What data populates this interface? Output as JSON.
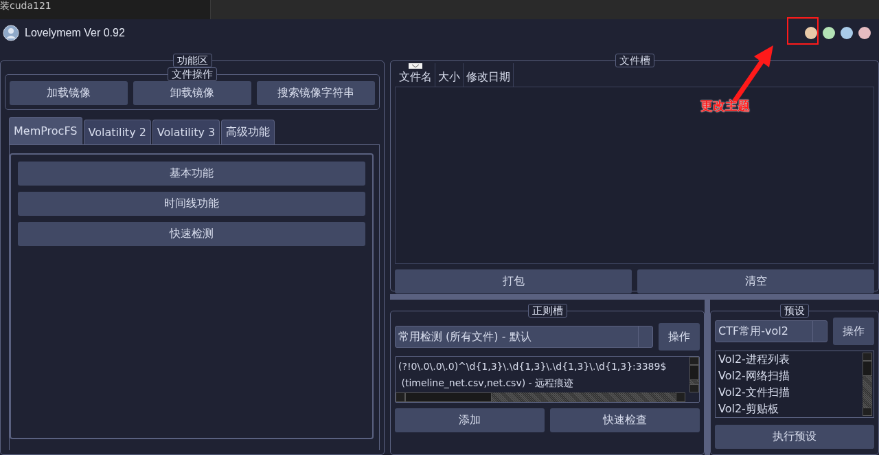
{
  "background_window": {
    "text": "装cuda121"
  },
  "window": {
    "title": "Lovelymem Ver 0.92",
    "theme_buttons": [
      {
        "color": "#e8c9a8"
      },
      {
        "color": "#b4e3b6"
      },
      {
        "color": "#a9cbe9"
      },
      {
        "color": "#e6bcc1"
      }
    ]
  },
  "function_area": {
    "title": "功能区",
    "file_ops": {
      "title": "文件操作",
      "buttons": [
        "加载镜像",
        "卸载镜像",
        "搜索镜像字符串"
      ]
    },
    "tabs": [
      {
        "label": "MemProcFS",
        "selected": true
      },
      {
        "label": "Volatility 2",
        "selected": false
      },
      {
        "label": "Volatility 3",
        "selected": false
      },
      {
        "label": "高级功能",
        "selected": false
      }
    ],
    "tab_buttons": [
      "基本功能",
      "时间线功能",
      "快速检测"
    ]
  },
  "file_slot": {
    "title": "文件槽",
    "columns": [
      {
        "label": "文件名",
        "sorted": true
      },
      {
        "label": "大小",
        "sorted": false
      },
      {
        "label": "修改日期",
        "sorted": false
      }
    ],
    "buttons": [
      "打包",
      "清空"
    ]
  },
  "regex_slot": {
    "title": "正则槽",
    "selector": "常用检测 (所有文件) - 默认",
    "action_button": "操作",
    "lines": [
      "(?!0\\.0\\.0\\.0)^\\d{1,3}\\.\\d{1,3}\\.\\d{1,3}\\.\\d{1,3}:3389$",
      " (timeline_net.csv,net.csv) - 远程痕迹"
    ],
    "buttons": [
      "添加",
      "快速检查"
    ]
  },
  "preset": {
    "title": "预设",
    "selector": "CTF常用-vol2",
    "action_button": "操作",
    "items": [
      "Vol2-进程列表",
      "Vol2-网络扫描",
      "Vol2-文件扫描",
      "Vol2-剪贴板"
    ],
    "run_button": "执行预设"
  },
  "annotation": {
    "text": "更改主题"
  }
}
